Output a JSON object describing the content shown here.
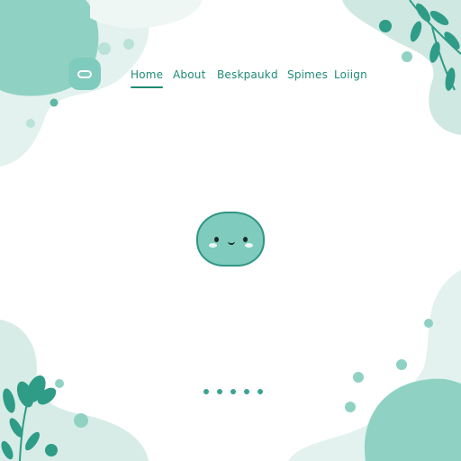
{
  "nav": {
    "items": [
      {
        "label": "Home",
        "active": true
      },
      {
        "label": "About",
        "active": false
      },
      {
        "label": "Beskpaukd",
        "active": false
      },
      {
        "label": "Spimes",
        "active": false
      },
      {
        "label": "Loiign",
        "active": false
      }
    ]
  },
  "pager": {
    "page_count": 5
  },
  "colors": {
    "accent": "#1f8a77",
    "mint": "#7fcbbd",
    "pale_mint": "#d7ece6",
    "leaf": "#2e9c86"
  },
  "icons": {
    "logo": "rounded-square-logo-icon",
    "mascot": "smiling-blob-mascot-icon",
    "leaves": "leaf-branch-icon"
  }
}
